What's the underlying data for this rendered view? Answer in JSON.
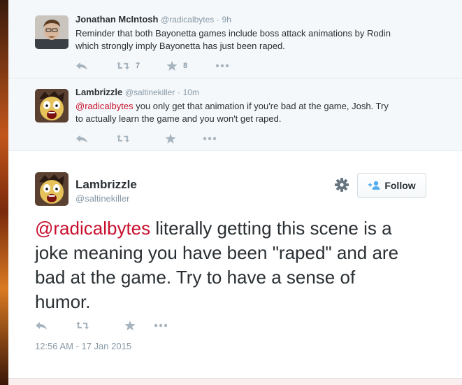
{
  "conversation": [
    {
      "fullname": "Jonathan McIntosh",
      "screen_name": "@radicalbytes",
      "separator": "·",
      "time": "9h",
      "text_lines": [
        "Reminder that both Bayonetta games include boss attack animations by Rodin",
        "which strongly imply Bayonetta has just been raped."
      ],
      "retweets": "7",
      "favorites": "8",
      "avatar_icon": "person-photo-icon"
    },
    {
      "fullname": "Lambrizzle",
      "screen_name": "@saltinekiller",
      "separator": "·",
      "time": "10m",
      "mention": "@radicalbytes",
      "text_line1_rest": " you only get that animation if you're bad at the game, Josh. Try",
      "text_line2": "to actually learn the game and you won't get raped.",
      "retweets": "",
      "favorites": "",
      "avatar_icon": "cartoon-face-icon"
    }
  ],
  "main_tweet": {
    "fullname": "Lambrizzle",
    "screen_name": "@saltinekiller",
    "follow_label": "Follow",
    "mention": "@radicalbytes",
    "text_line1_rest": " literally getting this scene is a",
    "text_line2": "joke meaning you have been \"raped\" and are",
    "text_line3": "bad at the game. Try to have a sense of",
    "text_line4": "humor.",
    "timestamp": "12:56 AM - 17 Jan 2015",
    "avatar_icon": "cartoon-face-icon"
  },
  "colors": {
    "mention": "#c8102e",
    "muted": "#8899a6",
    "icon": "#a8b5bf",
    "follow_icon": "#55acee"
  }
}
